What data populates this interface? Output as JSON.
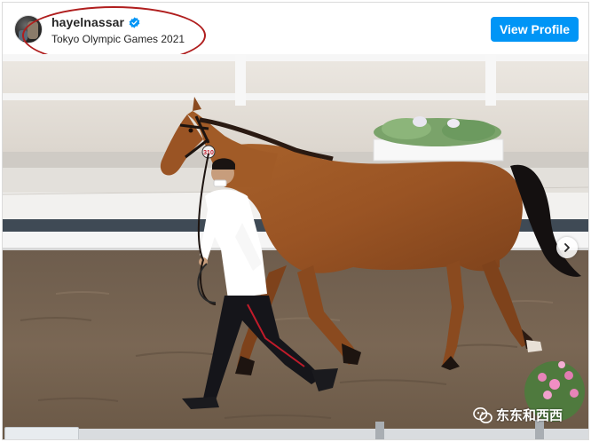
{
  "post": {
    "username": "hayelnassar",
    "location": "Tokyo Olympic Games 2021",
    "view_profile_label": "View Profile"
  },
  "watermark": {
    "text": "东东和西西"
  },
  "icons": {
    "verified": "verified-badge-icon",
    "next": "chevron-right-icon",
    "watermark": "wechat-icon"
  },
  "colors": {
    "accent": "#0095f6",
    "highlight": "#b01e1e",
    "username": "#262626"
  }
}
